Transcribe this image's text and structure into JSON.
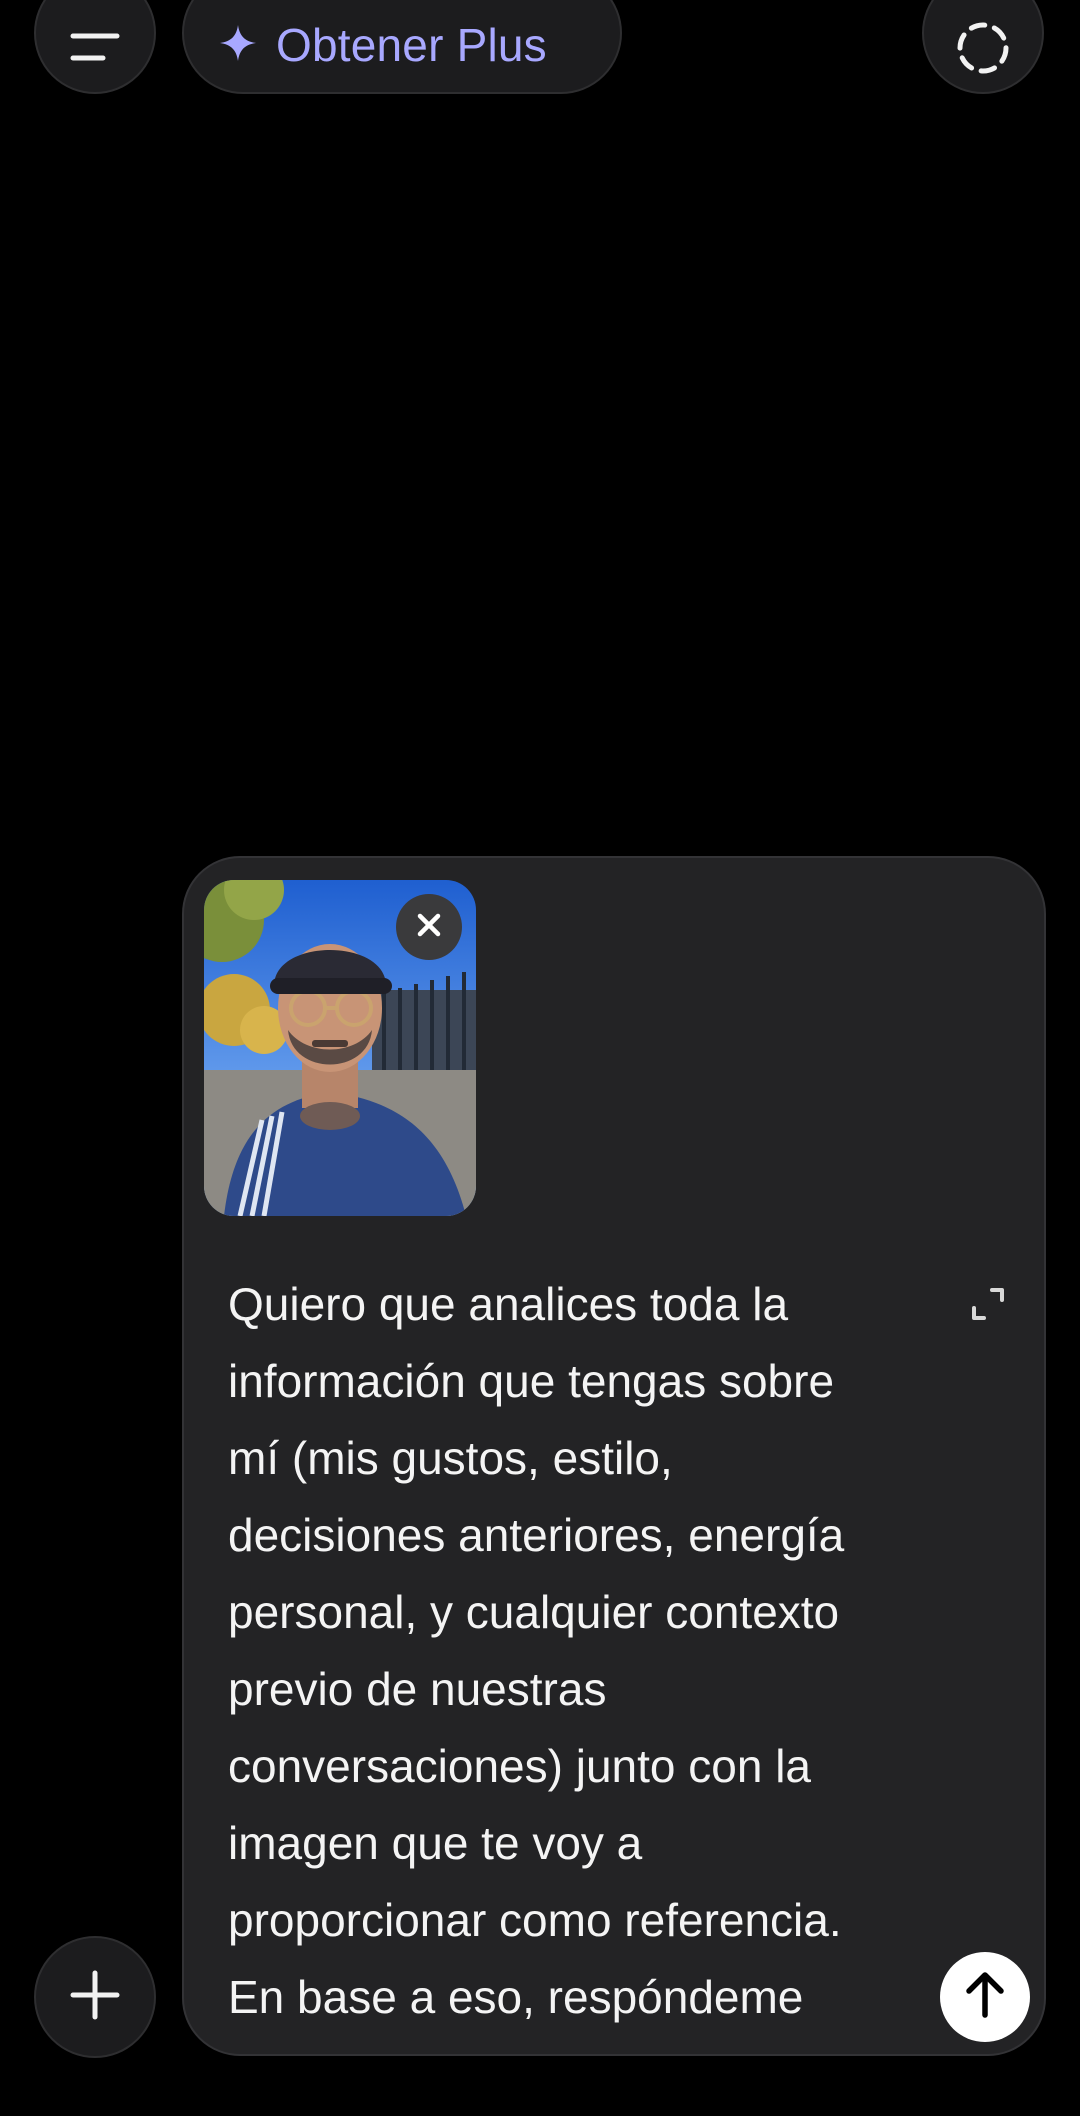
{
  "header": {
    "menu_icon": "menu-icon",
    "upgrade_label": "Obtener Plus",
    "upgrade_icon": "sparkle-icon",
    "temporary_chat_icon": "dashed-circle-icon",
    "accent_color": "#a8a8ff"
  },
  "composer": {
    "attachment": {
      "type": "image",
      "remove_icon": "close-icon"
    },
    "expand_icon": "expand-icon",
    "text": "Quiero que analices toda la\ninformación que tengas sobre\nmí (mis gustos, estilo,\ndecisiones anteriores, energía\npersonal, y cualquier contexto\nprevio de nuestras\nconversaciones) junto con la\nimagen que te voy a\nproporcionar como referencia.\nEn base a eso, respóndeme",
    "send_icon": "arrow-up-icon"
  },
  "footer": {
    "add_icon": "plus-icon"
  }
}
